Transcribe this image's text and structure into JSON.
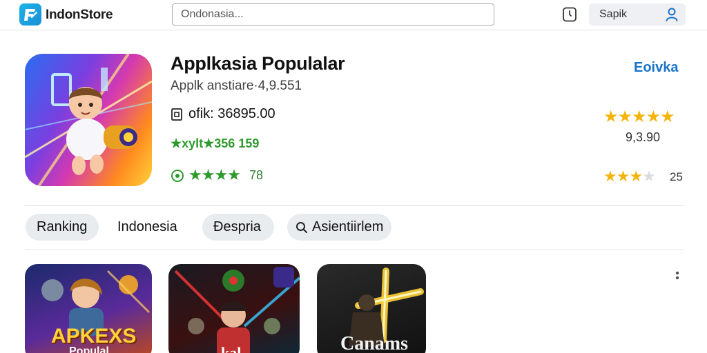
{
  "header": {
    "brand": "IndonStore",
    "search_placeholder": "Ondonasia...",
    "signin_label": "Sapik",
    "icons": [
      "store-logo-icon",
      "phone-icon",
      "user-icon"
    ]
  },
  "featured": {
    "title": "Applkasia Populalar",
    "subtitle": "Applk anstiare·4,9.551",
    "info": "ofik: 36895.00",
    "green_text": "★xylt★356 159",
    "rating_stars": "★★★★",
    "rating_value": "78",
    "link_label": "Eoivka",
    "big_stars": "★★★★★",
    "rating_count": "9,3.90",
    "small_stars_full": "★★★",
    "small_stars_empty": "★",
    "small_count": "25"
  },
  "chips": [
    {
      "label": "Ranking"
    },
    {
      "label": "Indonesia"
    },
    {
      "label": "Ɖespria"
    },
    {
      "label": "Asientiirlem"
    }
  ],
  "apps": [
    {
      "title": "APKEXS",
      "subtitle": "Populal"
    },
    {
      "title": "kal"
    },
    {
      "title": "Canams"
    }
  ],
  "colors": {
    "accent_blue": "#1a73c8",
    "green": "#2e9a2e",
    "star_gold": "#f3b50d",
    "chip_bg": "#e9ecef"
  }
}
